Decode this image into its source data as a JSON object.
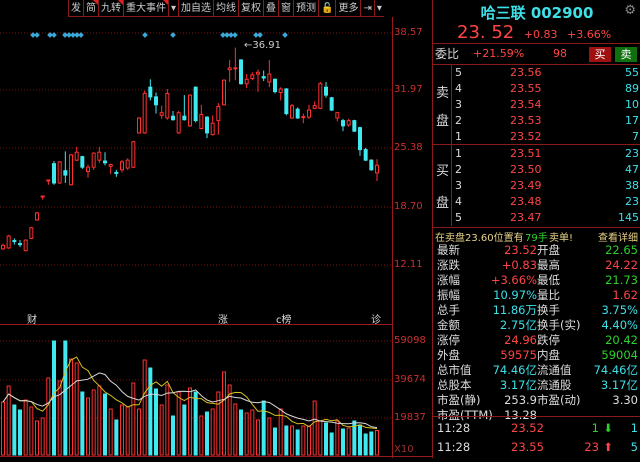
{
  "toolbar": {
    "items": [
      "发",
      "简",
      "九转",
      "重大事件",
      "▾",
      "加自选",
      "均线",
      "复权",
      "叠",
      "窗",
      "预测",
      "🔓",
      "更多",
      "⇥",
      "▾"
    ],
    "flags": [
      false,
      true,
      true,
      true,
      false,
      false,
      false,
      false,
      false,
      false,
      false,
      false,
      false,
      false,
      false
    ]
  },
  "axis": {
    "price_labels": [
      "38.57",
      "31.97",
      "25.38",
      "18.70",
      "12.11"
    ],
    "volume_labels": [
      "59098",
      "39674",
      "19837"
    ],
    "volume_unit": "X10",
    "max_label": "36.91"
  },
  "events": [
    {
      "label": "财"
    },
    {
      "label": "涨"
    },
    {
      "label": "c榜"
    },
    {
      "label": "诊"
    }
  ],
  "colors": {
    "up": "#ff3030",
    "down": "#40e8f0",
    "grid": "#7a1010",
    "ma5": "#d8c020",
    "ma10": "#d8d8d8"
  },
  "chart_data": {
    "type": "candlestick",
    "price_range": [
      9.0,
      39.2
    ],
    "volume_range": [
      0,
      70000
    ],
    "markers": [
      33,
      37,
      50,
      54,
      65,
      69,
      73,
      77,
      81,
      145,
      173,
      223,
      227,
      231,
      235,
      256,
      260,
      285
    ],
    "candles": [
      [
        14.0,
        14.4,
        14.6,
        13.9
      ],
      [
        14.11,
        15.47,
        15.6,
        14.0
      ],
      [
        14.95,
        14.85,
        15.2,
        14.5
      ],
      [
        14.6,
        14.5,
        15.0,
        14.2
      ],
      [
        13.8,
        15.0,
        15.1,
        13.7
      ],
      [
        15.2,
        16.4,
        16.5,
        15.1
      ],
      [
        17.3,
        18.1,
        18.2,
        17.2
      ],
      [
        20.0,
        20.02,
        20.05,
        19.6
      ],
      [
        21.8,
        21.84,
        21.9,
        21.3
      ],
      [
        23.7,
        21.5,
        24.0,
        21.3
      ],
      [
        21.5,
        23.9,
        24.0,
        21.4
      ],
      [
        22.9,
        22.4,
        25.1,
        21.5
      ],
      [
        21.3,
        24.7,
        24.8,
        21.2
      ],
      [
        24.1,
        25.0,
        25.6,
        24.0
      ],
      [
        24.5,
        23.3,
        24.6,
        23.1
      ],
      [
        22.8,
        23.3,
        23.6,
        22.1
      ],
      [
        23.3,
        24.9,
        25.0,
        23.0
      ],
      [
        24.1,
        25.0,
        25.6,
        23.8
      ],
      [
        24.0,
        23.8,
        25.0,
        23.5
      ],
      [
        23.4,
        23.6,
        23.7,
        22.5
      ],
      [
        22.7,
        22.6,
        23.0,
        22.2
      ],
      [
        23.0,
        23.9,
        24.1,
        22.7
      ],
      [
        23.2,
        24.1,
        24.3,
        23.0
      ],
      [
        23.3,
        26.2,
        26.3,
        23.2
      ],
      [
        27.2,
        28.9,
        29.0,
        27.1
      ],
      [
        27.2,
        31.7,
        32.0,
        27.1
      ],
      [
        32.4,
        31.3,
        33.3,
        30.9
      ],
      [
        31.3,
        30.4,
        31.8,
        29.4
      ],
      [
        29.2,
        29.5,
        30.3,
        28.8
      ],
      [
        28.9,
        31.7,
        32.2,
        28.7
      ],
      [
        29.1,
        28.7,
        29.7,
        28.6
      ],
      [
        27.2,
        29.5,
        29.7,
        27.1
      ],
      [
        29.1,
        28.7,
        31.5,
        28.6
      ],
      [
        28.0,
        31.5,
        31.6,
        27.9
      ],
      [
        32.4,
        28.6,
        32.5,
        28.4
      ],
      [
        27.7,
        29.3,
        30.4,
        27.6
      ],
      [
        29.0,
        27.2,
        29.1,
        26.6
      ],
      [
        27.0,
        28.3,
        29.2,
        26.9
      ],
      [
        28.6,
        30.2,
        30.6,
        27.0
      ],
      [
        30.4,
        33.2,
        33.3,
        30.3
      ],
      [
        34.4,
        34.6,
        35.5,
        33.0
      ],
      [
        34.5,
        34.6,
        36.91,
        33.2
      ],
      [
        35.5,
        32.8,
        35.6,
        32.7
      ],
      [
        32.8,
        33.3,
        33.9,
        32.3
      ],
      [
        33.4,
        33.8,
        34.1,
        33.2
      ],
      [
        33.9,
        34.1,
        34.4,
        31.9
      ],
      [
        33.6,
        33.45,
        34.3,
        33.1
      ],
      [
        33.0,
        33.9,
        35.5,
        32.4
      ],
      [
        33.3,
        31.9,
        33.4,
        31.7
      ],
      [
        31.8,
        32.2,
        32.4,
        30.9
      ],
      [
        32.2,
        29.4,
        32.3,
        29.2
      ],
      [
        28.9,
        30.3,
        30.5,
        28.8
      ],
      [
        29.9,
        28.9,
        30.1,
        28.8
      ],
      [
        28.95,
        29.05,
        29.4,
        28.3
      ],
      [
        29.0,
        29.8,
        30.4,
        28.8
      ],
      [
        30.0,
        30.3,
        30.8,
        29.9
      ],
      [
        30.0,
        32.8,
        33.0,
        29.9
      ],
      [
        32.4,
        31.5,
        33.0,
        31.2
      ],
      [
        31.2,
        29.8,
        31.3,
        29.7
      ],
      [
        28.9,
        29.5,
        29.6,
        28.5
      ],
      [
        28.6,
        28.0,
        28.8,
        27.4
      ],
      [
        28.1,
        28.6,
        28.8,
        27.9
      ],
      [
        28.6,
        27.4,
        28.7,
        27.3
      ],
      [
        27.8,
        25.3,
        27.9,
        24.6
      ],
      [
        25.3,
        24.1,
        25.5,
        24.0
      ],
      [
        24.1,
        23.0,
        24.2,
        22.9
      ],
      [
        22.65,
        23.52,
        24.22,
        21.73
      ]
    ],
    "volumes": [
      27030,
      35190,
      25500,
      22950,
      28050,
      24480,
      17340,
      18870,
      39270,
      58140,
      37740,
      58140,
      48960,
      46920,
      32130,
      29070,
      33150,
      35190,
      31110,
      23460,
      17850,
      25500,
      24480,
      36720,
      23460,
      48450,
      44370,
      33660,
      25500,
      35700,
      19890,
      32130,
      25500,
      34170,
      32130,
      19890,
      21930,
      23460,
      32130,
      42330,
      35700,
      26010,
      22950,
      21420,
      22950,
      17850,
      27540,
      18870,
      13770,
      23460,
      14790,
      14790,
      12750,
      14790,
      14790,
      27540,
      17340,
      16320,
      11220,
      17340,
      13260,
      13770,
      17340,
      15300,
      10710,
      11730,
      12500
    ]
  },
  "quote": {
    "name": "哈三联",
    "code": "002900",
    "price": "23. 52",
    "change": "+0.83",
    "pct": "+3.66%",
    "weibi_label": "委比",
    "weibi": "+21.59%",
    "weicha": "98",
    "buy_btn": "买",
    "sell_btn": "卖"
  },
  "sell": {
    "label1": "卖",
    "label2": "盘",
    "rows": [
      {
        "lv": "5",
        "p": "23.56",
        "v": "55"
      },
      {
        "lv": "4",
        "p": "23.55",
        "v": "89"
      },
      {
        "lv": "3",
        "p": "23.54",
        "v": "10"
      },
      {
        "lv": "2",
        "p": "23.53",
        "v": "17"
      },
      {
        "lv": "1",
        "p": "23.52",
        "v": "7"
      }
    ]
  },
  "buy": {
    "label1": "买",
    "label2": "盘",
    "rows": [
      {
        "lv": "1",
        "p": "23.51",
        "v": "23"
      },
      {
        "lv": "2",
        "p": "23.50",
        "v": "47"
      },
      {
        "lv": "3",
        "p": "23.49",
        "v": "38"
      },
      {
        "lv": "4",
        "p": "23.48",
        "v": "23"
      },
      {
        "lv": "5",
        "p": "23.47",
        "v": "145"
      }
    ]
  },
  "notice": {
    "a": "在卖盘23.60位置有",
    "b": "79手",
    "c": "卖单!",
    "link": "查看详细"
  },
  "stats": [
    {
      "k1": "最新",
      "v1": "23.52",
      "c1": "red",
      "k2": "开盘",
      "v2": "22.65",
      "c2": "green"
    },
    {
      "k1": "涨跌",
      "v1": "+0.83",
      "c1": "red",
      "k2": "最高",
      "v2": "24.22",
      "c2": "red"
    },
    {
      "k1": "涨幅",
      "v1": "+3.66%",
      "c1": "red",
      "k2": "最低",
      "v2": "21.73",
      "c2": "green"
    },
    {
      "k1": "振幅",
      "v1": "10.97%",
      "c1": "cyan",
      "k2": "量比",
      "v2": "1.62",
      "c2": "red"
    },
    {
      "k1": "总手",
      "v1": "11.86万",
      "c1": "cyan",
      "k2": "换手",
      "v2": "3.75%",
      "c2": "cyan"
    },
    {
      "k1": "金额",
      "v1": "2.75亿",
      "c1": "cyan",
      "k2": "换手(实)",
      "v2": "4.40%",
      "c2": "cyan"
    },
    {
      "k1": "涨停",
      "v1": "24.96",
      "c1": "red",
      "k2": "跌停",
      "v2": "20.42",
      "c2": "green"
    },
    {
      "k1": "外盘",
      "v1": "59575",
      "c1": "red",
      "k2": "内盘",
      "v2": "59004",
      "c2": "green"
    },
    {
      "k1": "总市值",
      "v1": "74.46亿",
      "c1": "cyan",
      "k2": "流通值",
      "v2": "74.46亿",
      "c2": "cyan"
    },
    {
      "k1": "总股本",
      "v1": "3.17亿",
      "c1": "cyan",
      "k2": "流通股",
      "v2": "3.17亿",
      "c2": "cyan"
    },
    {
      "k1": "市盈(静)",
      "v1": "253.9",
      "c1": "white",
      "k2": "市盈(动)",
      "v2": "3.30",
      "c2": "white"
    },
    {
      "k1": "市盈(TTM)",
      "v1": "13.28",
      "c1": "white",
      "k2": "",
      "v2": "",
      "c2": "white"
    }
  ],
  "ticks": [
    {
      "t": "11:28",
      "p": "23.52",
      "n": "1",
      "dir": "down",
      "s": "1"
    },
    {
      "t": "11:28",
      "p": "23.55",
      "n": "23",
      "dir": "up",
      "s": "5"
    }
  ]
}
